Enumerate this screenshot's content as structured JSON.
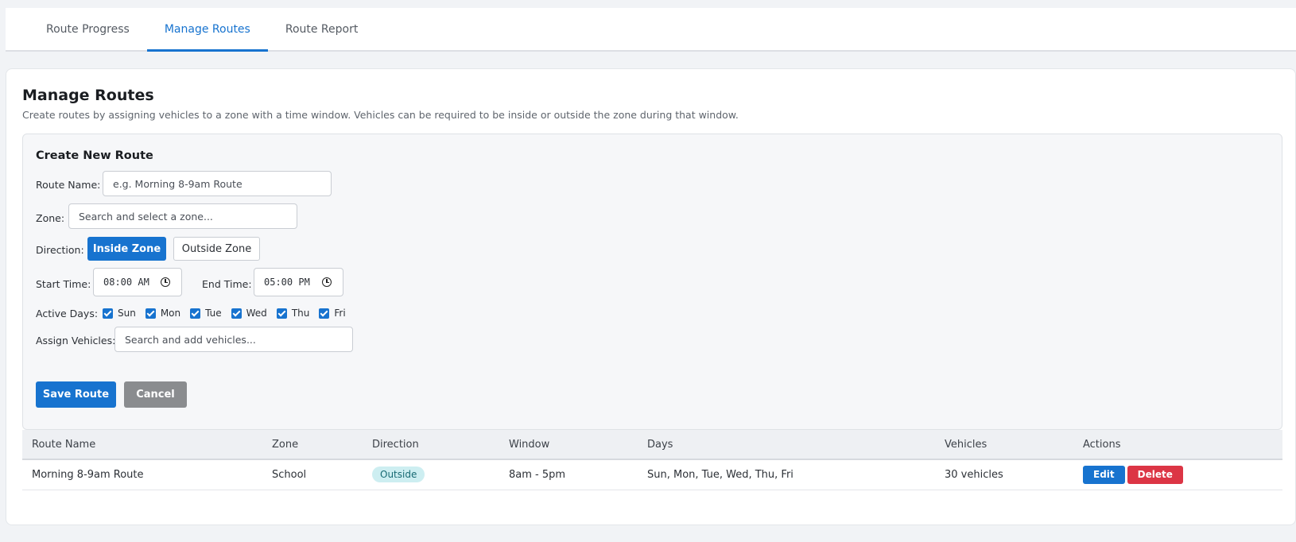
{
  "tabs": [
    {
      "label": "Route Progress",
      "active": false
    },
    {
      "label": "Manage Routes",
      "active": true
    },
    {
      "label": "Route Report",
      "active": false
    }
  ],
  "page": {
    "title": "Manage Routes",
    "subtitle": "Create routes by assigning vehicles to a zone with a time window. Vehicles can be required to be inside or outside the zone during that window."
  },
  "form": {
    "title": "Create New Route",
    "route_name_label": "Route Name:",
    "route_name_placeholder": "e.g. Morning 8-9am Route",
    "zone_label": "Zone:",
    "zone_placeholder": "Search and select a zone...",
    "direction_label": "Direction:",
    "direction_inside": "Inside Zone",
    "direction_outside": "Outside Zone",
    "start_time_label": "Start Time:",
    "start_time_value": "08:00 AM",
    "end_time_label": "End Time:",
    "end_time_value": "05:00 PM",
    "active_days_label": "Active Days:",
    "days": [
      {
        "label": "Sun",
        "checked": true
      },
      {
        "label": "Mon",
        "checked": true
      },
      {
        "label": "Tue",
        "checked": true
      },
      {
        "label": "Wed",
        "checked": true
      },
      {
        "label": "Thu",
        "checked": true
      },
      {
        "label": "Fri",
        "checked": true
      }
    ],
    "vehicles_label": "Assign Vehicles:",
    "vehicles_placeholder": "Search and add vehicles...",
    "save_label": "Save Route",
    "cancel_label": "Cancel"
  },
  "table": {
    "headers": [
      "Route Name",
      "Zone",
      "Direction",
      "Window",
      "Days",
      "Vehicles",
      "Actions"
    ],
    "rows": [
      {
        "route_name": "Morning 8-9am Route",
        "zone": "School",
        "direction": "Outside",
        "window": "8am - 5pm",
        "days": "Sun, Mon, Tue, Wed, Thu, Fri",
        "vehicles": "30 vehicles",
        "edit_label": "Edit",
        "delete_label": "Delete"
      }
    ]
  },
  "colors": {
    "accent": "#1773cf",
    "danger": "#dc3545",
    "badge_bg": "#cdeef1"
  }
}
